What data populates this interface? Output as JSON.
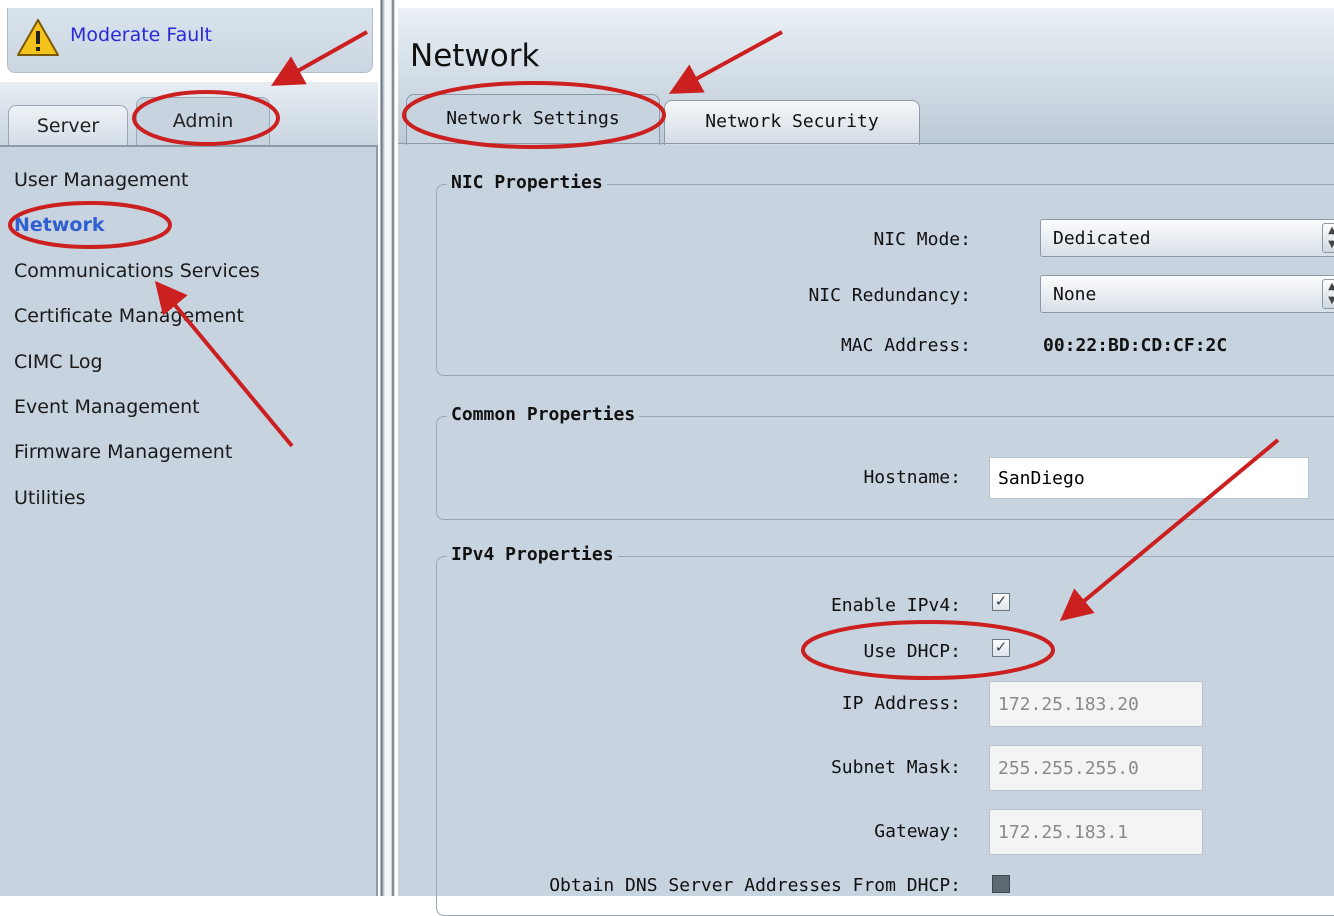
{
  "status": {
    "fault_text": "Moderate Fault",
    "icon": "warning-icon"
  },
  "left_tabs": {
    "server": "Server",
    "admin": "Admin"
  },
  "nav": {
    "items": [
      "User Management",
      "Network",
      "Communications Services",
      "Certificate Management",
      "CIMC Log",
      "Event Management",
      "Firmware Management",
      "Utilities"
    ],
    "active": "Network"
  },
  "page": {
    "title": "Network"
  },
  "tabs": {
    "network_settings": "Network Settings",
    "network_security": "Network Security"
  },
  "nic": {
    "title": "NIC Properties",
    "mode_label": "NIC Mode:",
    "mode_value": "Dedicated",
    "redundancy_label": "NIC Redundancy:",
    "redundancy_value": "None",
    "mac_label": "MAC Address:",
    "mac_value": "00:22:BD:CD:CF:2C"
  },
  "common": {
    "title": "Common Properties",
    "hostname_label": "Hostname:",
    "hostname_value": "SanDiego"
  },
  "ipv4": {
    "title": "IPv4 Properties",
    "enable_label": "Enable IPv4:",
    "enable_checked": true,
    "dhcp_label": "Use DHCP:",
    "dhcp_checked": true,
    "ip_label": "IP Address:",
    "ip_value": "172.25.183.20",
    "mask_label": "Subnet Mask:",
    "mask_value": "255.255.255.0",
    "gateway_label": "Gateway:",
    "gateway_value": "172.25.183.1",
    "dns_label": "Obtain DNS Server Addresses From DHCP:",
    "dns_checked": false
  },
  "colors": {
    "annotation": "#cc1f1f",
    "panel": "#c7d3df",
    "link": "#2a2ad6",
    "active_nav": "#2f5fd0"
  }
}
